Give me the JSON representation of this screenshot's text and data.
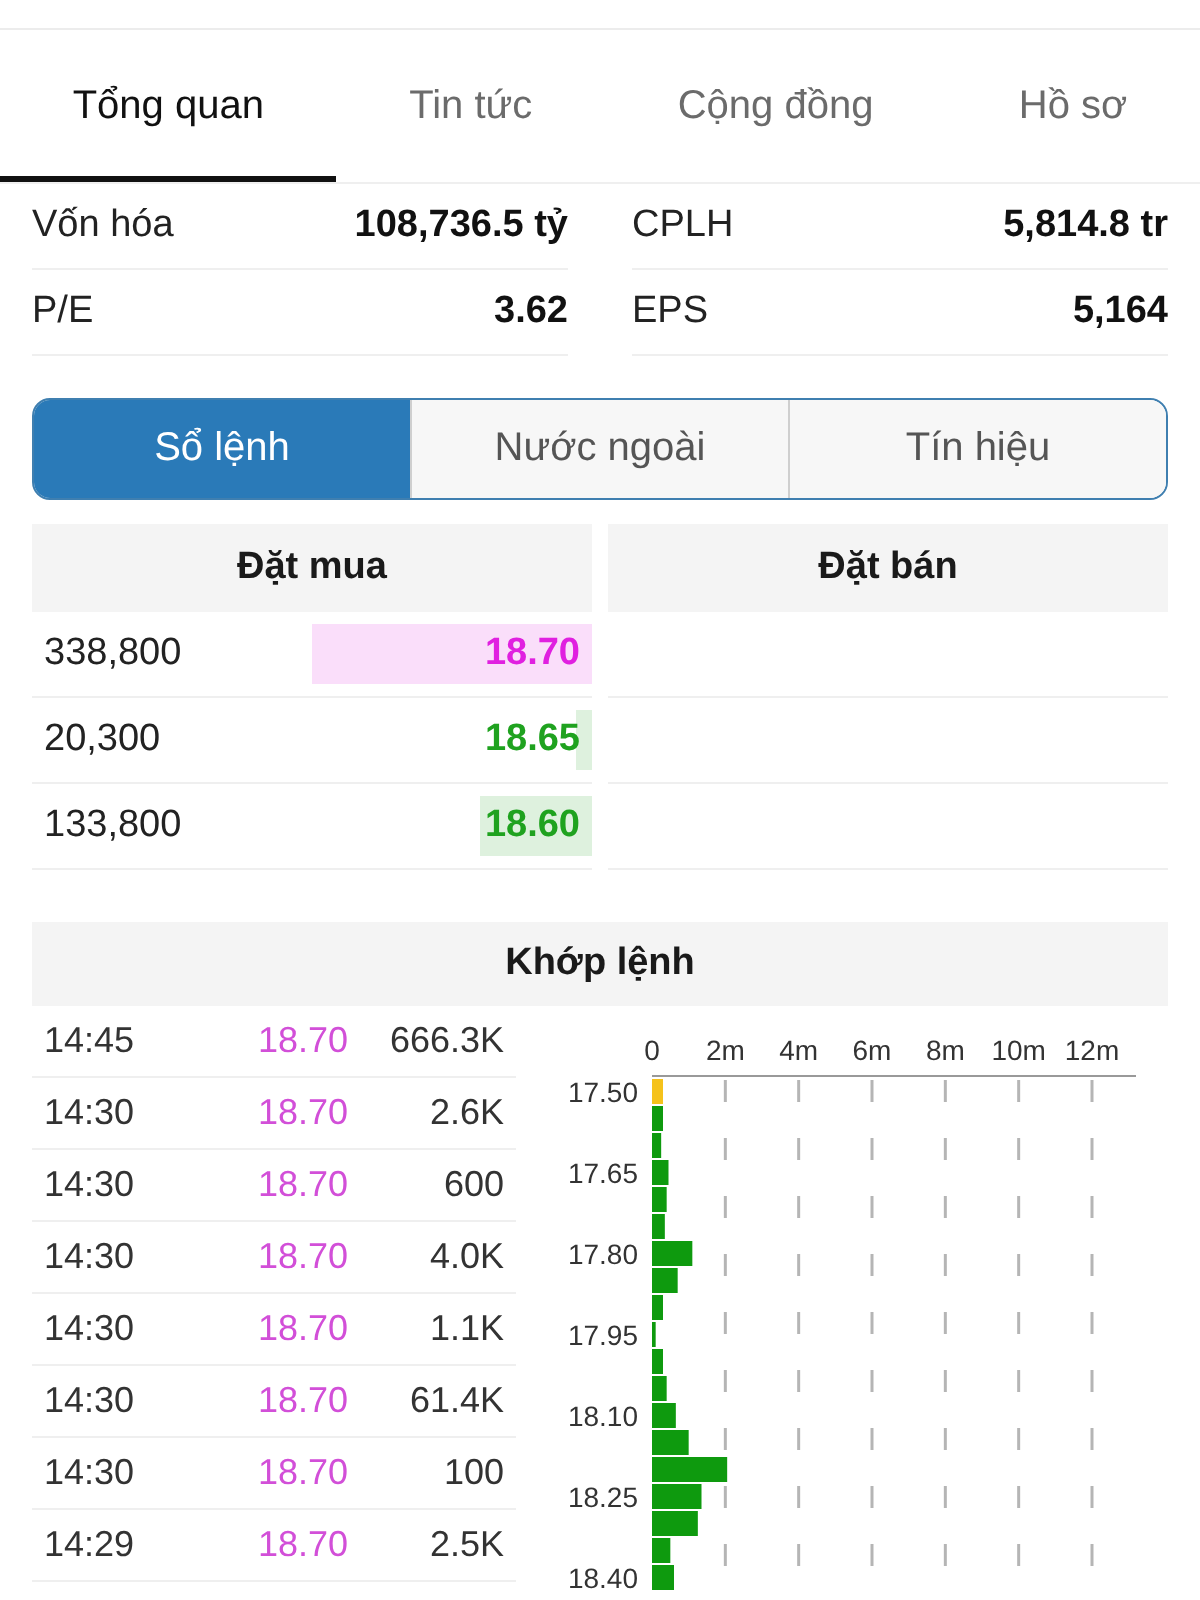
{
  "tabs": [
    {
      "label": "Tổng quan",
      "selected": true
    },
    {
      "label": "Tin tức",
      "selected": false
    },
    {
      "label": "Cộng đồng",
      "selected": false
    },
    {
      "label": "Hồ sơ",
      "selected": false
    }
  ],
  "stats": [
    {
      "label": "Vốn hóa",
      "value": "108,736.5 tỷ"
    },
    {
      "label": "CPLH",
      "value": "5,814.8 tr"
    },
    {
      "label": "P/E",
      "value": "3.62"
    },
    {
      "label": "EPS",
      "value": "5,164"
    }
  ],
  "segments": [
    {
      "label": "Sổ lệnh",
      "selected": true
    },
    {
      "label": "Nước ngoài",
      "selected": false
    },
    {
      "label": "Tín hiệu",
      "selected": false
    }
  ],
  "order_book": {
    "bid_header": "Đặt mua",
    "ask_header": "Đặt bán",
    "bids": [
      {
        "volume": "338,800",
        "price": "18.70",
        "color": "#e020e0",
        "level": 0.5
      },
      {
        "volume": "20,300",
        "price": "18.65",
        "color": "#1fa21f",
        "level": 0.03
      },
      {
        "volume": "133,800",
        "price": "18.60",
        "color": "#1fa21f",
        "level": 0.2
      }
    ]
  },
  "matches": {
    "title": "Khớp lệnh",
    "trades": [
      {
        "time": "14:45",
        "price": "18.70",
        "color": "#d24fd8",
        "volume": "666.3K"
      },
      {
        "time": "14:30",
        "price": "18.70",
        "color": "#d24fd8",
        "volume": "2.6K"
      },
      {
        "time": "14:30",
        "price": "18.70",
        "color": "#d24fd8",
        "volume": "600"
      },
      {
        "time": "14:30",
        "price": "18.70",
        "color": "#d24fd8",
        "volume": "4.0K"
      },
      {
        "time": "14:30",
        "price": "18.70",
        "color": "#d24fd8",
        "volume": "1.1K"
      },
      {
        "time": "14:30",
        "price": "18.70",
        "color": "#d24fd8",
        "volume": "61.4K"
      },
      {
        "time": "14:30",
        "price": "18.70",
        "color": "#d24fd8",
        "volume": "100"
      },
      {
        "time": "14:29",
        "price": "18.70",
        "color": "#d24fd8",
        "volume": "2.5K"
      }
    ],
    "chart_data": {
      "type": "bar",
      "orientation": "horizontal",
      "grid": true,
      "x": [
        17.5,
        17.55,
        17.6,
        17.65,
        17.7,
        17.75,
        17.8,
        17.85,
        17.9,
        17.95,
        18.0,
        18.05,
        18.1,
        18.15,
        18.2,
        18.25,
        18.3,
        18.35,
        18.4
      ],
      "series": [
        {
          "color": "#f5c21b",
          "values": [
            0.3,
            null,
            null,
            null,
            null,
            null,
            null,
            null,
            null,
            null,
            null,
            null,
            null,
            null,
            null,
            null,
            null,
            null,
            null
          ]
        },
        {
          "color": "#0e9a0e",
          "values": [
            null,
            0.3,
            0.25,
            0.45,
            0.4,
            0.35,
            1.1,
            0.7,
            0.3,
            0.1,
            0.3,
            0.4,
            0.65,
            1.0,
            2.05,
            1.35,
            1.25,
            0.5,
            0.6
          ]
        }
      ],
      "xlim": [
        0,
        13.2
      ],
      "ylim": [
        18.425,
        17.475
      ],
      "xticks": [
        {
          "value": 0,
          "label": "0"
        },
        {
          "value": 2,
          "label": "2m"
        },
        {
          "value": 4,
          "label": "4m"
        },
        {
          "value": 6,
          "label": "6m"
        },
        {
          "value": 8,
          "label": "8m"
        },
        {
          "value": 10,
          "label": "10m"
        },
        {
          "value": 12,
          "label": "12m"
        }
      ],
      "yticks": [
        {
          "value": 17.5,
          "label": "17.50"
        },
        {
          "value": 17.65,
          "label": "17.65"
        },
        {
          "value": 17.8,
          "label": "17.80"
        },
        {
          "value": 17.95,
          "label": "17.95"
        },
        {
          "value": 18.1,
          "label": "18.10"
        },
        {
          "value": 18.25,
          "label": "18.25"
        },
        {
          "value": 18.4,
          "label": "18.40"
        }
      ]
    }
  }
}
